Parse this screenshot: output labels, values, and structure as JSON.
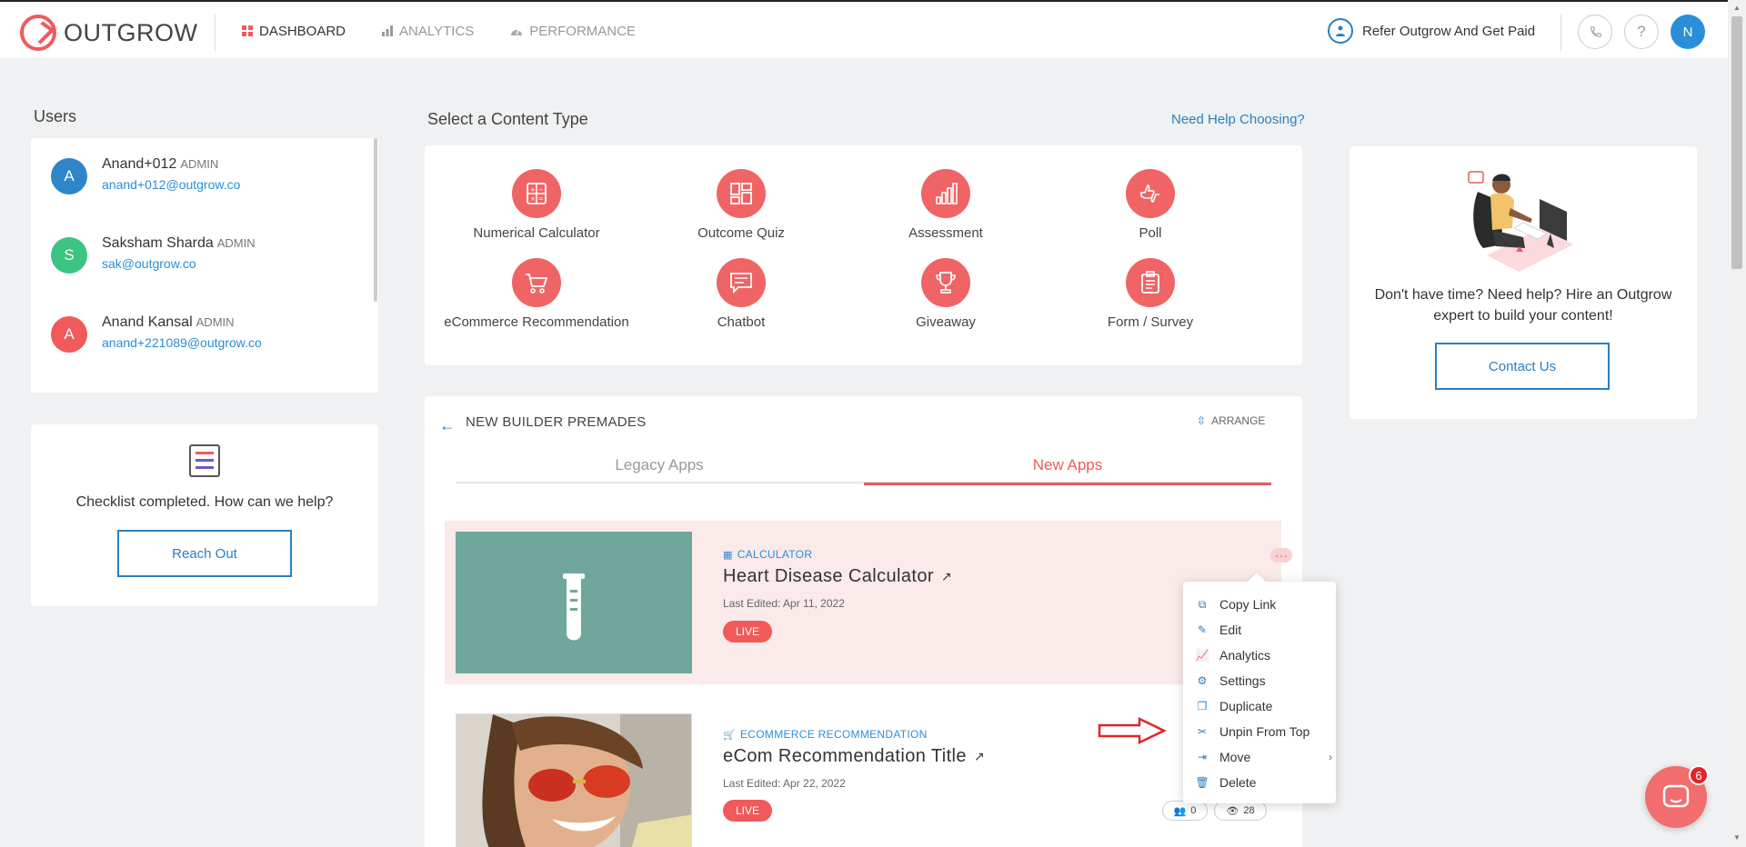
{
  "topbar": {
    "logo_text": "OUTGROW",
    "nav": [
      {
        "label": "DASHBOARD",
        "active": true
      },
      {
        "label": "ANALYTICS",
        "active": false
      },
      {
        "label": "PERFORMANCE",
        "active": false
      }
    ],
    "refer_label": "Refer Outgrow And Get Paid",
    "help_glyph": "?",
    "avatar_initial": "N"
  },
  "users": {
    "title": "Users",
    "list": [
      {
        "initial": "A",
        "name": "Anand+012",
        "role": "ADMIN",
        "email": "anand+012@outgrow.co",
        "color": "#2e86c8"
      },
      {
        "initial": "S",
        "name": "Saksham Sharda",
        "role": "ADMIN",
        "email": "sak@outgrow.co",
        "color": "#3cc482"
      },
      {
        "initial": "A",
        "name": "Anand Kansal",
        "role": "ADMIN",
        "email": "anand+221089@outgrow.co",
        "color": "#f05a5b"
      }
    ]
  },
  "checklist": {
    "text": "Checklist completed. How can we help?",
    "button": "Reach Out"
  },
  "content_type": {
    "title": "Select a Content Type",
    "help_link": "Need Help Choosing?",
    "items": [
      {
        "label": "Numerical Calculator",
        "icon": "calculator-icon"
      },
      {
        "label": "Outcome Quiz",
        "icon": "quiz-grid-icon"
      },
      {
        "label": "Assessment",
        "icon": "bar-chart-icon"
      },
      {
        "label": "Poll",
        "icon": "thumbs-icon"
      },
      {
        "label": "eCommerce Recommendation",
        "icon": "cart-icon"
      },
      {
        "label": "Chatbot",
        "icon": "chat-icon"
      },
      {
        "label": "Giveaway",
        "icon": "trophy-icon"
      },
      {
        "label": "Form / Survey",
        "icon": "clipboard-icon"
      }
    ]
  },
  "premades": {
    "title": "NEW BUILDER PREMADES",
    "arrange_label": "ARRANGE",
    "tabs": [
      {
        "label": "Legacy Apps",
        "active": false
      },
      {
        "label": "New Apps",
        "active": true
      }
    ],
    "apps": [
      {
        "category": "CALCULATOR",
        "title": "Heart Disease Calculator",
        "edited": "Last Edited: Apr 11, 2022",
        "status": "LIVE",
        "users": "",
        "views": ""
      },
      {
        "category": "ECOMMERCE RECOMMENDATION",
        "title": "eCom Recommendation Title",
        "edited": "Last Edited: Apr 22, 2022",
        "status": "LIVE",
        "users": "0",
        "views": "28"
      }
    ]
  },
  "menu": {
    "items": [
      {
        "label": "Copy Link",
        "icon": "copy-link-icon"
      },
      {
        "label": "Edit",
        "icon": "pencil-icon"
      },
      {
        "label": "Analytics",
        "icon": "line-chart-icon"
      },
      {
        "label": "Settings",
        "icon": "gear-icon"
      },
      {
        "label": "Duplicate",
        "icon": "duplicate-icon"
      },
      {
        "label": "Unpin From Top",
        "icon": "unpin-icon"
      },
      {
        "label": "Move",
        "icon": "move-icon",
        "has_submenu": true
      },
      {
        "label": "Delete",
        "icon": "trash-icon"
      }
    ]
  },
  "expert": {
    "text": "Don't have time? Need help? Hire an Outgrow expert to build your content!",
    "button": "Contact Us"
  },
  "chat": {
    "badge": "6"
  },
  "colors": {
    "accent": "#f05a5b",
    "link": "#2a7fc2",
    "thumb_teal": "#6fa79c"
  }
}
